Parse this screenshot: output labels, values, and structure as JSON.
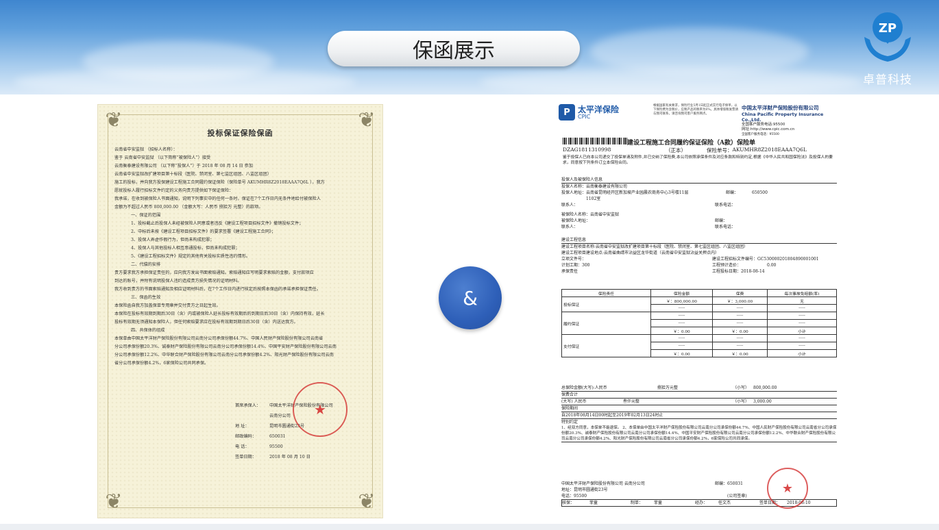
{
  "header": {
    "title": "保函展示",
    "logo_mark": "ZP",
    "logo_text": "卓普科技"
  },
  "separator": {
    "symbol": "&"
  },
  "left_doc": {
    "title": "投标保证保险保函",
    "lines": [
      "云南省中安监狱                （招标人名称）：",
      "    鉴于    云南省中安监狱                                    （以下简称“被保险人”）接受",
      "云南衡泰建设有限公司                           （以下称“投保人”）于    2018 年  08 月  14 日 参加",
      "云南省中安监狱改扩建项目第十标段（医院、禁闭室、第七监区组团、八监区组团）",
      "施工的投标，并向我方投保建设工程施工合同履约保证保险（保险单号  AKUMHR8Z2018EAAA7Q6L  ），我方",
      "愿就投标人履行招标文件约定的义务向贵方提供如下保证保险：",
      "    我承诺，在收到被保险人书面通知，说明下列事实中的任何一条时，保证在7个工作日内无条件地给付被保险人",
      "金额为不超过人民币 800,000.00          （金额大写：人民币    捌拾万              元整）的款项。"
    ],
    "sections": [
      {
        "heading": "一、保证的范围",
        "items": [
          "1、投标截止后投保人未经被保险人同意或者违反《建设工程项目招标文件》撤销投标文件；",
          "2、中标后未按《建设工程项目招标文件》的要求签署《建设工程施工合同》；",
          "3、投保人弄虚作假行为，但尚未构成犯罪；",
          "4、投保人与其他投标人相互串通投标，但尚未构成犯罪；",
          "5、《建设工程招标文件》规定的其他有关投标实质性违约情形。"
        ]
      },
      {
        "heading": "二、代偿的安排",
        "items": [
          "    贵方要求我方承担保证责任的，应向我方发出书面索赔通知。索赔通知应写明要求索赔的金额，支付款项应",
          "到达的账号，并附有说明投保人违约造成贵方损失情况的证明材料。",
          "    我方收到贵方的书面索赔通知及相应证明材料后，在7个工作日内进行核定后按照本保函的承诺承担保证责任。"
        ]
      },
      {
        "heading": "三、保函的生效",
        "items": [
          "    本保险函自我方加盖保单专用章并交付贵方之日起生效。",
          "    本保险在投标有效期到期后30日（含）内或被保险人延长投标有效期后的到期日后30日（含）内保持有效，延长",
          "投标有效期无须通知本保险人，但任何索赔要求应在投标有效期到期日后30日（含）内送达我方。"
        ]
      },
      {
        "heading": "四、共保体的组成",
        "items": [
          "    本保单由中国太平洋财产保险股份有限公司云南分公司承保份额44.7%、中国人民财产保险股份有限公司云南省",
          "分公司承保份额20.3%、诚泰财产保险股份有限公司云南分公司承保份额14.4%、中国平安财产保险股份有限公司云南",
          "分公司承保份额12.2%、中华联合财产保险股份有限公司云南分公司承保份额4.2%、阳光财产保险股份有限公司云南",
          "省分公司承保份额4.2%，6家保险公司共同承保。"
        ]
      }
    ],
    "signature": [
      {
        "k": "首席承保人：",
        "v": "中国太平洋财产保险股份有限公司"
      },
      {
        "k": "",
        "v": "云南分公司"
      },
      {
        "k": "地      址：",
        "v": "昆明市圆通街23号"
      },
      {
        "k": "邮政编码：",
        "v": "650031"
      },
      {
        "k": "电      话：",
        "v": "95500"
      },
      {
        "k": "签单日期：",
        "v": "2018 年 08 月 10 日"
      }
    ]
  },
  "right_doc": {
    "brand_cn": "太平洋保险",
    "brand_en": "CPIC",
    "notice": "根据国家有关要求，保险行业5月1日起正式实行电子保单，以下保险费为含税价，应税产品的税率为6%。具体增值税发票请与我司联系，请咨询我司客户服务网点。",
    "company_cn": "中国太平洋财产保险股份有限公司",
    "company_en": "China Pacific Property Insurance Co.,Ltd.",
    "hotline": "全国客户服务电话:95500",
    "website": "网址:http://www.cpic.com.cn",
    "hotline_small": "全国客户服务电话：95500",
    "policy_title": "建设工程施工合同履约保证保险（A款）保险单",
    "serial": "DZAG1811310998",
    "copy_label": "（正本）",
    "policy_no_label": "保险单号：",
    "policy_no": "AKUMHR8Z2018EAAA7Q6L",
    "intro": "鉴于投保人已向本公司递交了投保单请及附件,并已交纳了保险费,本公司依照承保条件及对应条款和特别约定,根据《中华人民共和国保险法》及投保人的要求，同意按下列条件订立本保险合同。",
    "section1": {
      "heading": "投保人及被保险人信息",
      "applicant_name_label": "投保人名称：",
      "applicant_name": "云南衡泰建设有限公司",
      "applicant_addr_label": "投保人地址：",
      "applicant_addr": "云南省昆明经开区新加坡产业园晨农商务中心3号楼11层1102室",
      "contact_label": "联系人：",
      "zip_label": "邮编：",
      "zip": "650500",
      "phone_label": "联系电话：",
      "insured_name_label": "被保险人名称：",
      "insured_name": "云南省中安监狱",
      "insured_addr_label": "被保险人地址：",
      "contact2_label": "联系人：",
      "zip2_label": "邮编：",
      "phone2_label": "联系电话："
    },
    "section2": {
      "heading": "建设工程信息",
      "project_name_label": "建设工程项目名称:",
      "project_name": "云南省中安监狱改扩建项目第十标段（医院、禁闭室、第七监区组团、八监区组团）",
      "project_site_label": "建设工程项目建设地点:",
      "project_site": "云南省曲靖市沾益区龙华街道（云南省中安监狱沾益关押点内）",
      "doc_no_label": "立项文件号：",
      "tender_no_label": "建设工程招标文件编号：",
      "tender_no": "GC530000201804890001001",
      "period_label": "计划工期：",
      "period": "300",
      "cost_label": "工程预计造价：",
      "cost": "0.00",
      "duty_label": "承保责任",
      "tender_date_label": "工程投标日期：",
      "tender_date": "2018-08-14"
    },
    "table": {
      "headers": [
        "保险责任",
        "保险金额",
        "保费",
        "每次事故免赔额(率)"
      ],
      "rows": [
        {
          "label": "投标保证",
          "amount": "￥：800,000.00",
          "premium": "￥：3,000.00",
          "deduct": "无"
        },
        {
          "label": "履约保证",
          "amount": "-----",
          "premium": "-----",
          "deduct": "-----"
        },
        {
          "label": "小计",
          "amount": "￥：0.00",
          "premium": "￥：0.00",
          "deduct": ""
        },
        {
          "label": "支付保证",
          "amount": "-----",
          "premium": "-----",
          "deduct": "-----"
        },
        {
          "label": "小计",
          "amount": "￥：0.00",
          "premium": "￥：0.00",
          "deduct": ""
        }
      ]
    },
    "totals": {
      "sum_label": "总保险金额(大写):人民币",
      "sum_cn": "捌拾万元整",
      "sum_small_label": "（小写）",
      "sum_small": "800,000.00",
      "premium_heading": "保费合计",
      "premium_label": "(大写) 人民币",
      "premium_cn": "叁仟元整",
      "premium_small_label": "（小写）",
      "premium_small": "3,000.00",
      "period_heading": "保险期间",
      "period_text": "自2018年08月14日00时起至2019年02月13日24时止",
      "special_heading": "特别约定",
      "special_text": "1、经双方同意，本保单不能退保。 2、本保单由中国太平洋财产保险股份有限公司云南分公司承保份额44.7%、中国人民财产保险股份有限公司云南省分公司承保份额20.3%、诚泰财产保险股份有限公司云南分公司承保份额14.4%、中国平安财产保险股份有限公司云南分公司承保份额12.2%、中华联合财产保险股份有限公司云南分公司承保份额4.2%、阳光财产保险股份有限公司云南省分公司承保份额4.2%，6家保险公司共同承保。"
    },
    "footer": {
      "company": "中国太平洋财产保险股份有限公司  云南分公司",
      "zip_label": "邮编：",
      "zip": "650031",
      "addr_label": "地址：",
      "addr": "昆明市圆通街23号",
      "phone_label": "电话：",
      "phone": "95500",
      "seal_label": "(公司签章)",
      "checker_label": "核保：",
      "checker": "菲童",
      "maker_label": "制单：",
      "maker": "菲童",
      "handler_label": "经办：",
      "handler": "任文杰",
      "date_label": "签单日期：",
      "date": "2018-08-10"
    }
  },
  "colors": {
    "accent": "#2e5fb8",
    "header_blue": "#4a8fd4",
    "stamp_red": "#d22828"
  }
}
